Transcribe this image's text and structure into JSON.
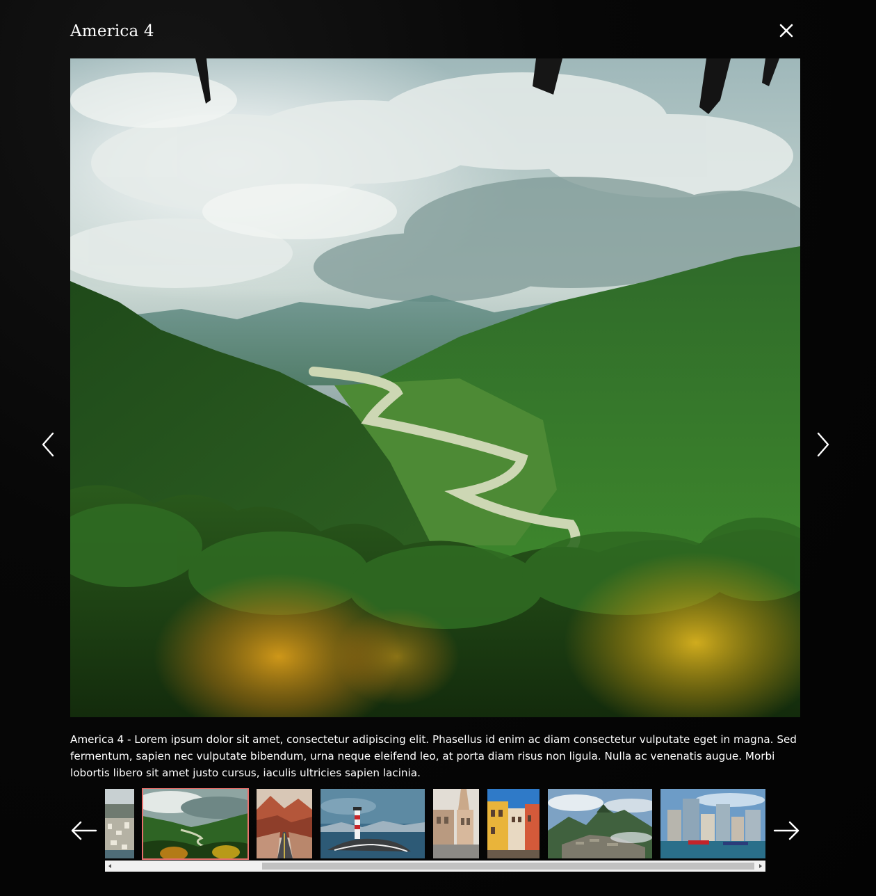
{
  "lightbox": {
    "title": "America 4",
    "caption": "America 4 - Lorem ipsum dolor sit amet, consectetur adipiscing elit. Phasellus id enim ac diam consectetur vulputate eget in magna. Sed fermentum, sapien nec vulputate bibendum, urna neque eleifend leo, at porta diam risus non ligula. Nulla ac venenatis augue. Morbi lobortis libero sit amet justo cursus, iaculis ultricies sapien lacinia.",
    "icons": {
      "close": "close-icon",
      "previous": "chevron-left-icon",
      "next": "chevron-right-icon",
      "strip_previous": "arrow-left-icon",
      "strip_next": "arrow-right-icon"
    },
    "colors": {
      "active_thumbnail_border": "#e8706c",
      "overlay": "#050505"
    },
    "thumbnails": [
      {
        "subject": "coastal-town-photo"
      },
      {
        "subject": "green-valley-photo",
        "active": true
      },
      {
        "subject": "desert-road-photo"
      },
      {
        "subject": "lighthouse-island-photo"
      },
      {
        "subject": "colonial-street-photo"
      },
      {
        "subject": "colorful-buildings-photo"
      },
      {
        "subject": "machu-picchu-photo"
      },
      {
        "subject": "harbor-city-photo"
      }
    ]
  }
}
